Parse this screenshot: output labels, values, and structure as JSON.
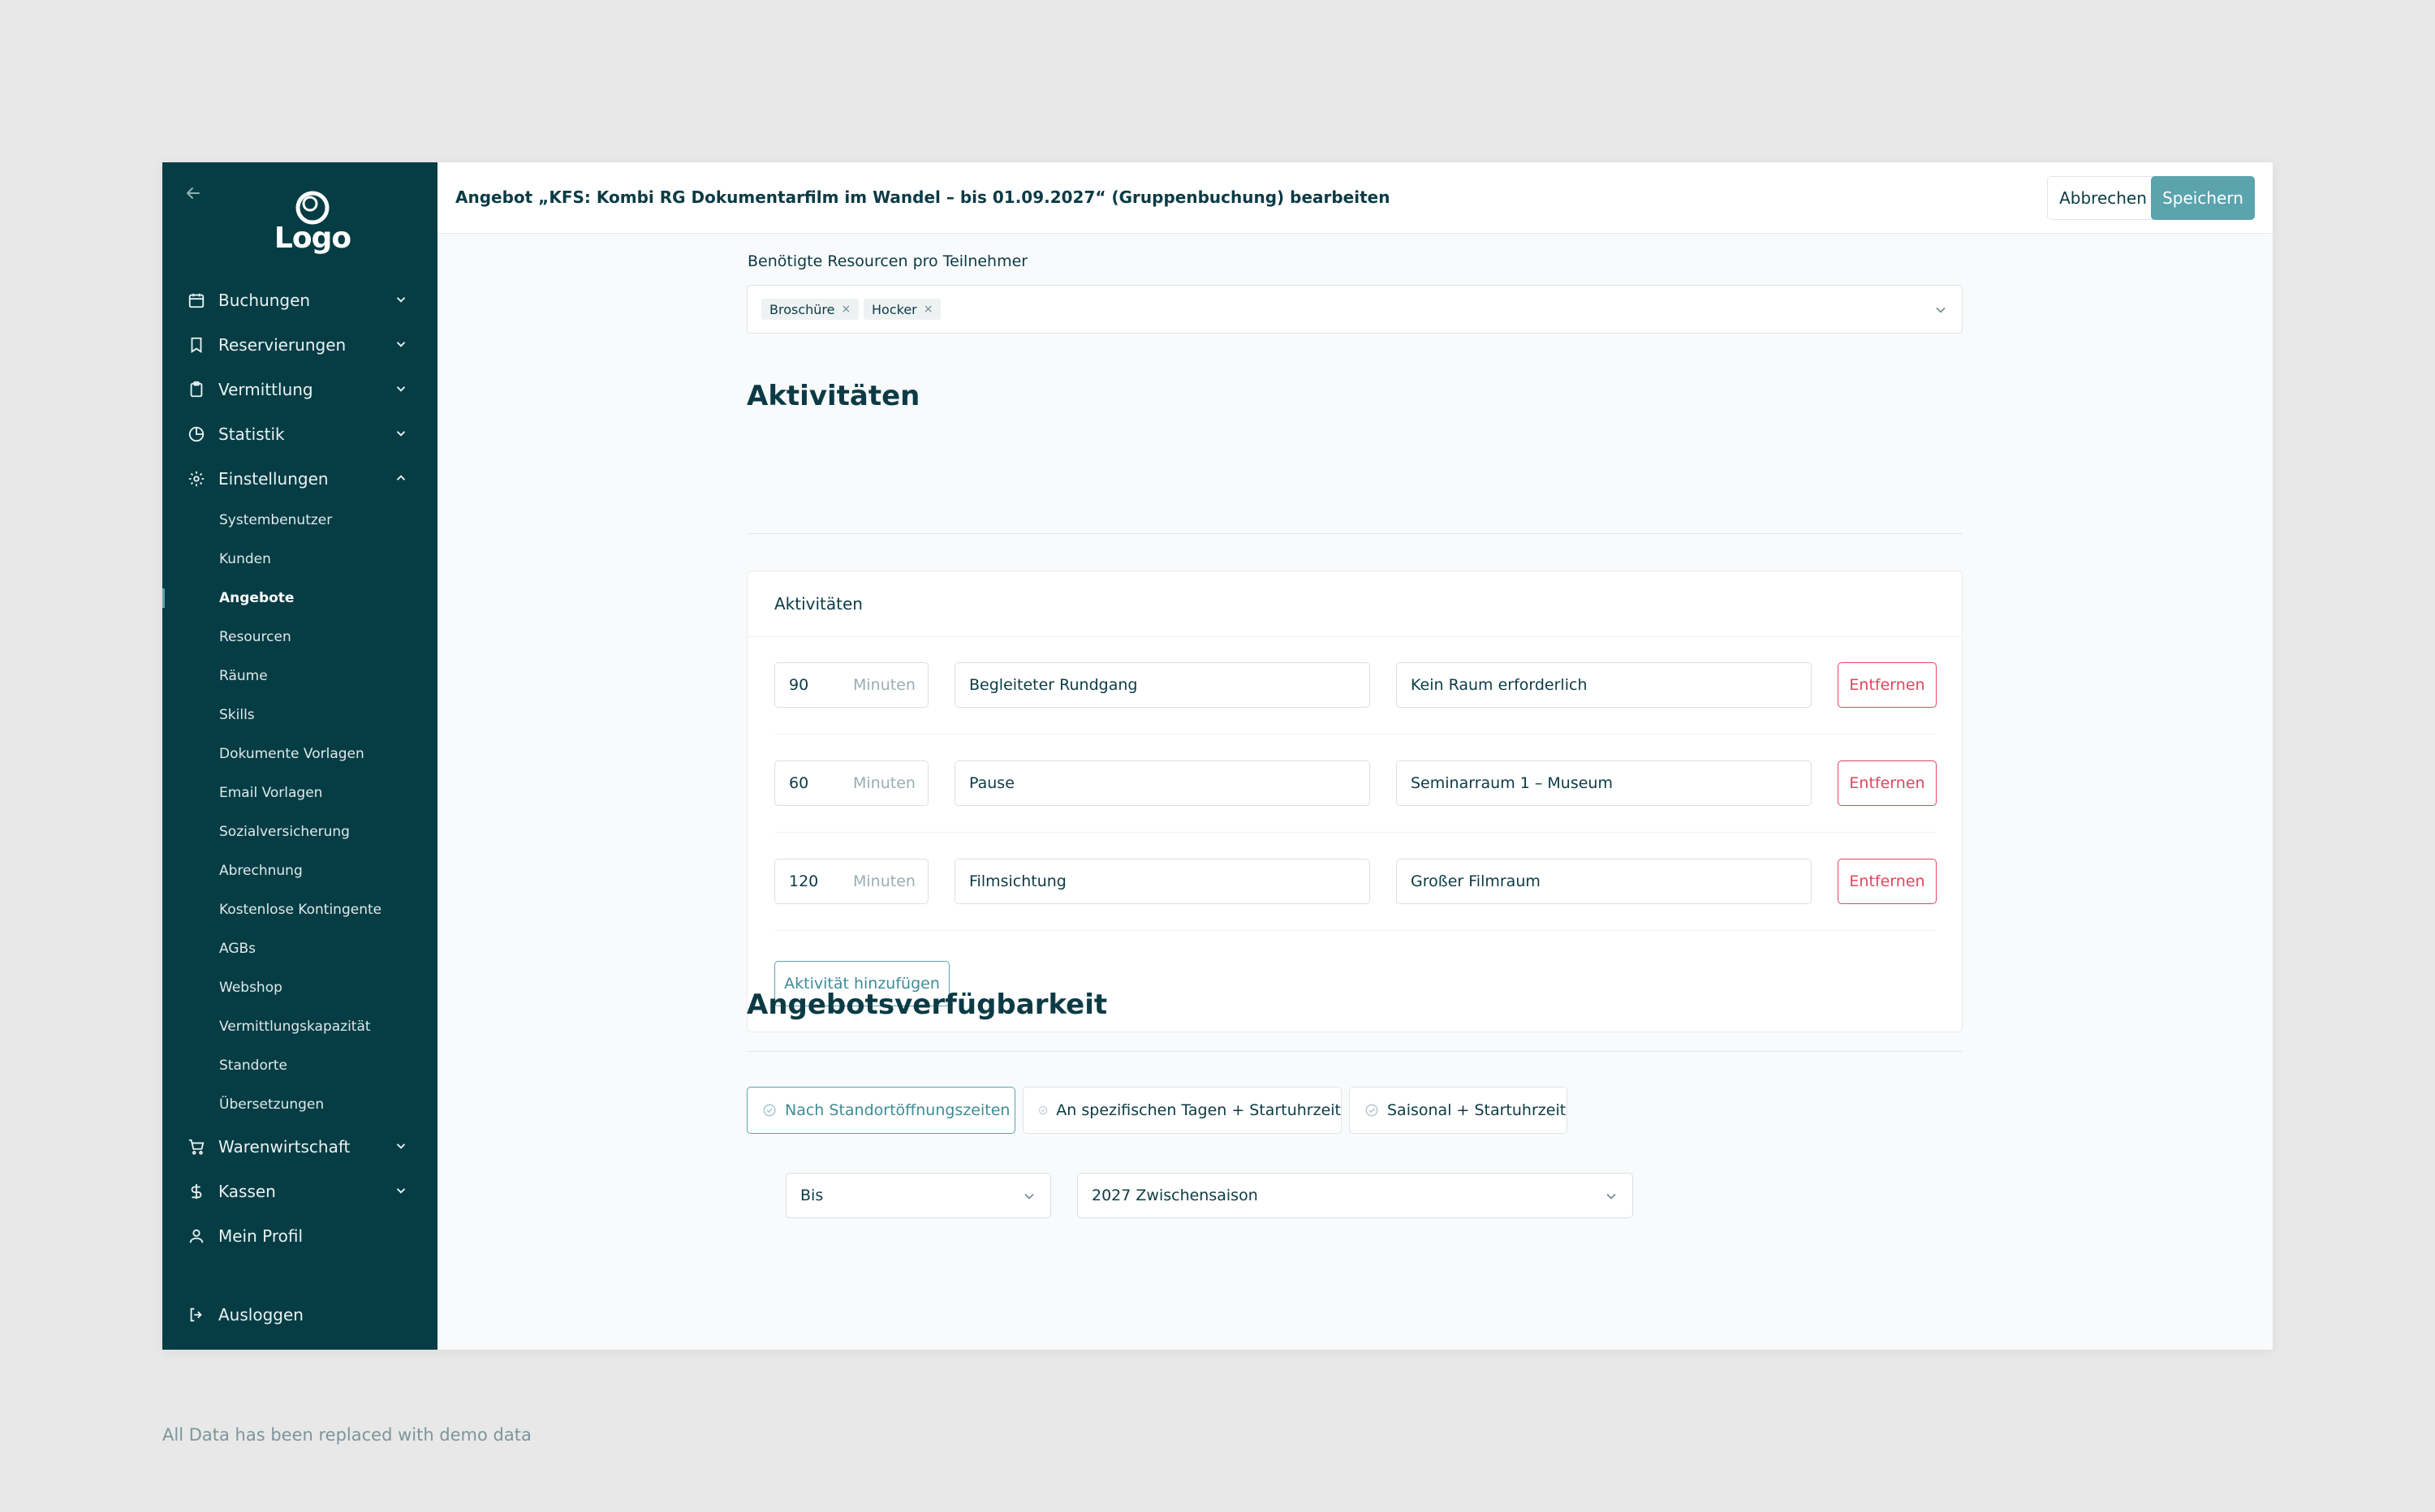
{
  "sidebar": {
    "logo_text": "Logo",
    "items": [
      {
        "label": "Buchungen",
        "icon": "calendar-icon"
      },
      {
        "label": "Reservierungen",
        "icon": "bookmark-icon"
      },
      {
        "label": "Vermittlung",
        "icon": "clipboard-icon"
      },
      {
        "label": "Statistik",
        "icon": "pie-chart-icon"
      },
      {
        "label": "Einstellungen",
        "icon": "gear-icon"
      }
    ],
    "sub_items": [
      "Systembenutzer",
      "Kunden",
      "Angebote",
      "Resourcen",
      "Räume",
      "Skills",
      "Dokumente Vorlagen",
      "Email Vorlagen",
      "Sozialversicherung",
      "Abrechnung",
      "Kostenlose Kontingente",
      "AGBs",
      "Webshop",
      "Vermittlungskapazität",
      "Standorte",
      "Übersetzungen"
    ],
    "active_sub_item": "Angebote",
    "items_after": [
      {
        "label": "Warenwirtschaft",
        "icon": "cart-icon"
      },
      {
        "label": "Kassen",
        "icon": "dollar-icon"
      },
      {
        "label": "Mein Profil",
        "icon": "user-icon"
      }
    ],
    "logout_label": "Ausloggen"
  },
  "header": {
    "title": "Angebot „KFS: Kombi RG Dokumentarfilm im Wandel – bis 01.09.2027“ (Gruppenbuchung) bearbeiten",
    "cancel_label": "Abbrechen",
    "save_label": "Speichern"
  },
  "resources": {
    "label": "Benötigte Resourcen pro Teilnehmer",
    "tags": [
      "Broschüre",
      "Hocker"
    ]
  },
  "activities": {
    "heading": "Aktivitäten",
    "card_title": "Aktivitäten",
    "unit": "Minuten",
    "remove_label": "Entfernen",
    "add_label": "Aktivität hinzufügen",
    "rows": [
      {
        "minutes": "90",
        "name": "Begleiteter Rundgang",
        "room": "Kein Raum erforderlich"
      },
      {
        "minutes": "60",
        "name": "Pause",
        "room": "Seminarraum 1 – Museum"
      },
      {
        "minutes": "120",
        "name": "Filmsichtung",
        "room": "Großer Filmraum"
      }
    ]
  },
  "availability": {
    "heading": "Angebotsverfügbarkeit",
    "options": [
      "Nach Standortöffnungszeiten",
      "An spezifischen Tagen + Startuhrzeit",
      "Saisonal + Startuhrzeit"
    ],
    "selected_option": "Nach Standortöffnungszeiten",
    "bis_select": "Bis",
    "season_select": "2027 Zwischensaison"
  },
  "footnote": "All Data has been replaced with demo data",
  "colors": {
    "sidebar_bg": "#063d45",
    "accent": "#5ba3ad",
    "danger": "#e0455e",
    "text": "#0c3b45"
  }
}
